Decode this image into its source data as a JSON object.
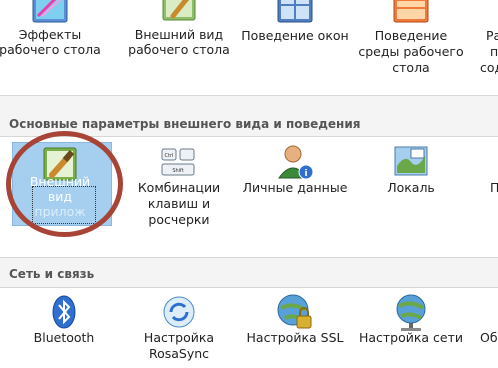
{
  "top_row": {
    "items": [
      {
        "label_lines": [
          "Эффекты",
          "рабочего стола"
        ],
        "icon": "desktop-effects-icon"
      },
      {
        "label_lines": [
          "Внешний вид",
          "рабочего стола"
        ],
        "icon": "workspace-appearance-icon"
      },
      {
        "label_lines": [
          "Поведение окон"
        ],
        "icon": "window-behavior-icon"
      },
      {
        "label_lines": [
          "Поведение",
          "среды рабочего",
          "стола"
        ],
        "icon": "workspace-behavior-icon"
      }
    ],
    "cut_partial": [
      "Ра",
      "п",
      "сод"
    ]
  },
  "groups": [
    {
      "title": "Основные параметры внешнего вида и поведения",
      "items": [
        {
          "label_lines": [
            "Внешний",
            "вид",
            "прилож"
          ],
          "icon": "application-appearance-icon",
          "selected": true
        },
        {
          "label_lines": [
            "Комбинации",
            "клавиш и",
            "росчерки"
          ],
          "icon": "shortcuts-icon"
        },
        {
          "label_lines": [
            "Личные данные"
          ],
          "icon": "personal-info-icon"
        },
        {
          "label_lines": [
            "Локаль"
          ],
          "icon": "locale-icon"
        }
      ],
      "cut_partial": [
        "П"
      ]
    },
    {
      "title": "Сеть и связь",
      "items": [
        {
          "label_lines": [
            "Bluetooth"
          ],
          "icon": "bluetooth-icon"
        },
        {
          "label_lines": [
            "Настройка",
            "RosaSync"
          ],
          "icon": "rosasync-icon"
        },
        {
          "label_lines": [
            "Настройка SSL"
          ],
          "icon": "ssl-lock-icon"
        },
        {
          "label_lines": [
            "Настройка сети"
          ],
          "icon": "network-globe-icon"
        }
      ],
      "cut_partial": [
        "Об"
      ]
    }
  ],
  "colors": {
    "selection": "#a6cfef",
    "annotation_circle": "#a74437",
    "group_title": "#555555"
  }
}
